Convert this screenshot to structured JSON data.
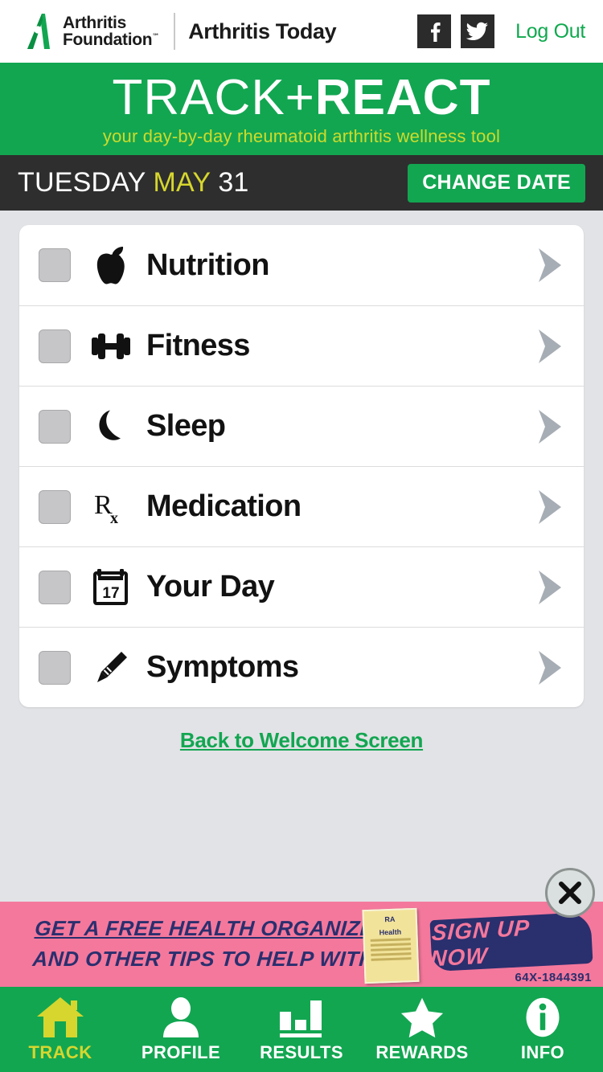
{
  "brand": {
    "org_line1": "Arthritis",
    "org_line2": "Foundation",
    "trademark": "℠",
    "publication": "Arthritis Today",
    "facebook_icon": "facebook-icon",
    "twitter_icon": "twitter-icon",
    "logout_label": "Log Out"
  },
  "hero": {
    "title_light": "TRACK+",
    "title_bold": "REACT",
    "tagline": "your day-by-day rheumatoid arthritis wellness tool",
    "accent_green": "#12a651",
    "accent_yellow": "#cddb2a"
  },
  "datebar": {
    "weekday": "TUESDAY",
    "month": "MAY",
    "day": "31",
    "change_date_label": "CHANGE DATE",
    "bar_color": "#2e2e2e",
    "month_color": "#d6d62e"
  },
  "tracker": {
    "rows": [
      {
        "label": "Nutrition",
        "icon": "apple-icon",
        "checked": false
      },
      {
        "label": "Fitness",
        "icon": "dumbbell-icon",
        "checked": false
      },
      {
        "label": "Sleep",
        "icon": "moon-icon",
        "checked": false
      },
      {
        "label": "Medication",
        "icon": "rx-icon",
        "checked": false
      },
      {
        "label": "Your Day",
        "icon": "calendar-icon",
        "checked": false
      },
      {
        "label": "Symptoms",
        "icon": "pencil-icon",
        "checked": false
      }
    ],
    "calendar_day": "17",
    "chevron_icon": "chevron-right-icon",
    "back_link": "Back to Welcome Screen",
    "link_color": "#12a651"
  },
  "ad": {
    "line1": "GET A FREE HEALTH ORGANIZER",
    "line2": "AND OTHER TIPS TO HELP WITH RA.",
    "cta": "SIGN UP NOW",
    "code": "64X-1844391",
    "book_title_1": "RA",
    "book_title_2": "Health",
    "background": "#f4789c",
    "ink": "#2a2f6e",
    "close_icon": "close-icon"
  },
  "nav": {
    "items": [
      {
        "label": "TRACK",
        "icon": "home-icon",
        "active": true
      },
      {
        "label": "PROFILE",
        "icon": "person-icon",
        "active": false
      },
      {
        "label": "RESULTS",
        "icon": "bar-chart-icon",
        "active": false
      },
      {
        "label": "REWARDS",
        "icon": "star-icon",
        "active": false
      },
      {
        "label": "INFO",
        "icon": "info-icon",
        "active": false
      }
    ],
    "active_color": "#d6d62e",
    "bar_color": "#12a651"
  }
}
